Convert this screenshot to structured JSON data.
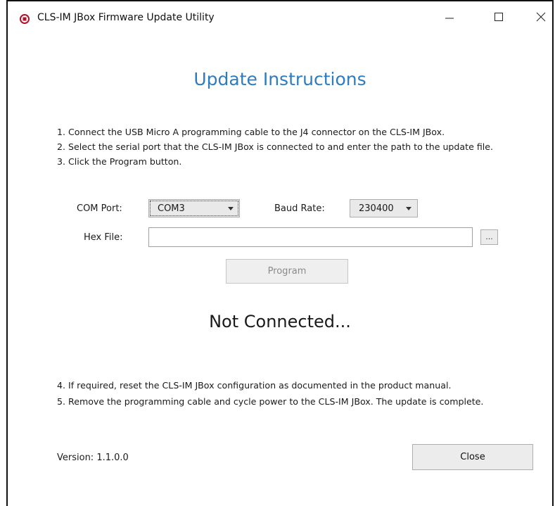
{
  "window": {
    "title": "CLS-IM JBox Firmware Update Utility",
    "icons": {
      "app": "chip-icon",
      "minimize": "minimize-icon",
      "maximize": "maximize-icon",
      "close": "close-icon"
    }
  },
  "heading": "Update Instructions",
  "instructions_top": [
    "1. Connect the USB Micro A programming cable to the J4 connector on the CLS-IM JBox.",
    "2. Select the serial port that the CLS-IM JBox is connected to and enter the path to the update file.",
    "3. Click the Program button."
  ],
  "form": {
    "com_port_label": "COM Port:",
    "com_port_value": "COM3",
    "baud_rate_label": "Baud Rate:",
    "baud_rate_value": "230400",
    "hex_file_label": "Hex File:",
    "hex_file_value": "",
    "browse_label": "...",
    "program_label": "Program"
  },
  "status": "Not Connected...",
  "instructions_bottom": [
    "4. If required, reset the CLS-IM JBox configuration as documented in the product manual.",
    "5. Remove the programming cable and cycle power to the CLS-IM JBox. The update is complete."
  ],
  "footer": {
    "version": "Version: 1.1.0.0",
    "close_label": "Close"
  },
  "colors": {
    "heading": "#2e7bbf",
    "app_icon": "#b0122b",
    "disabled_text": "#8a8a8a"
  }
}
